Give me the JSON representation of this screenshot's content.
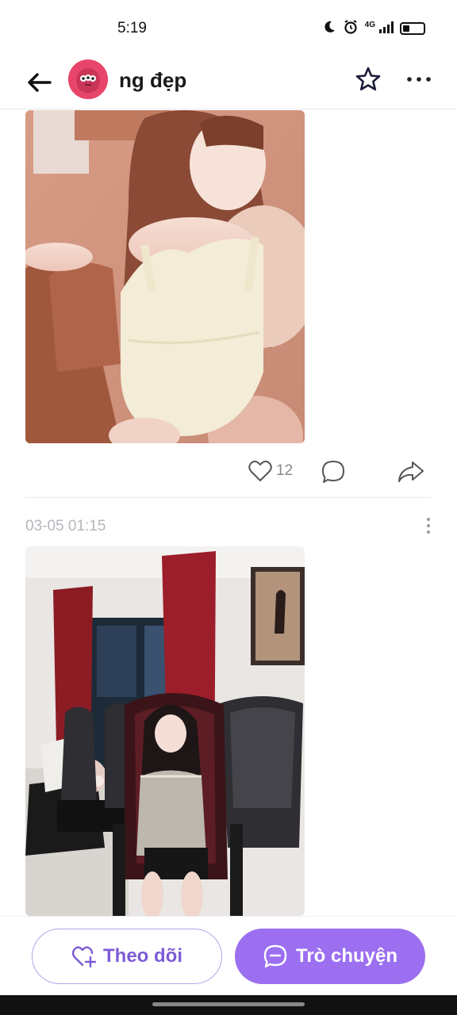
{
  "status_bar": {
    "time": "5:19",
    "network": "4G",
    "icons": [
      "moon-icon",
      "alarm-icon",
      "signal-icon",
      "battery-icon"
    ]
  },
  "header": {
    "title": "ng đẹp",
    "icons": [
      "back-arrow-icon",
      "star-icon",
      "more-icon"
    ]
  },
  "posts": [
    {
      "likes": "12",
      "image": "photo of a woman in a cream tank top seated on a wooden chair"
    },
    {
      "timestamp": "03-05 01:15",
      "image": "photo of a woman in a tweed top seated on a large dark chair in a living room with red curtains"
    }
  ],
  "bottom": {
    "follow_label": "Theo dõi",
    "chat_label": "Trò chuyện"
  },
  "colors": {
    "accent": "#9b6ff0",
    "follow_text": "#7d5bd6",
    "avatar_bg": "#e8456a"
  }
}
